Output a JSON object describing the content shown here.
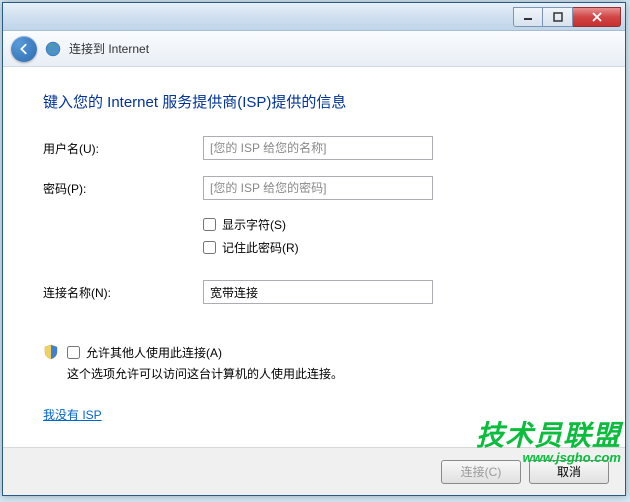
{
  "window": {
    "title": "连接到 Internet"
  },
  "page": {
    "heading": "键入您的 Internet 服务提供商(ISP)提供的信息"
  },
  "form": {
    "username_label": "用户名(U):",
    "username_placeholder": "[您的 ISP 给您的名称]",
    "username_value": "",
    "password_label": "密码(P):",
    "password_placeholder": "[您的 ISP 给您的密码]",
    "password_value": "",
    "show_chars_label": "显示字符(S)",
    "remember_password_label": "记住此密码(R)",
    "connection_name_label": "连接名称(N):",
    "connection_name_value": "宽带连接"
  },
  "allow_others": {
    "label": "允许其他人使用此连接(A)",
    "description": "这个选项允许可以访问这台计算机的人使用此连接。"
  },
  "link": {
    "no_isp": "我没有 ISP"
  },
  "buttons": {
    "connect": "连接(C)",
    "cancel": "取消"
  },
  "watermark": {
    "cn": "技术员联盟",
    "url": "www.jsgho.com"
  }
}
